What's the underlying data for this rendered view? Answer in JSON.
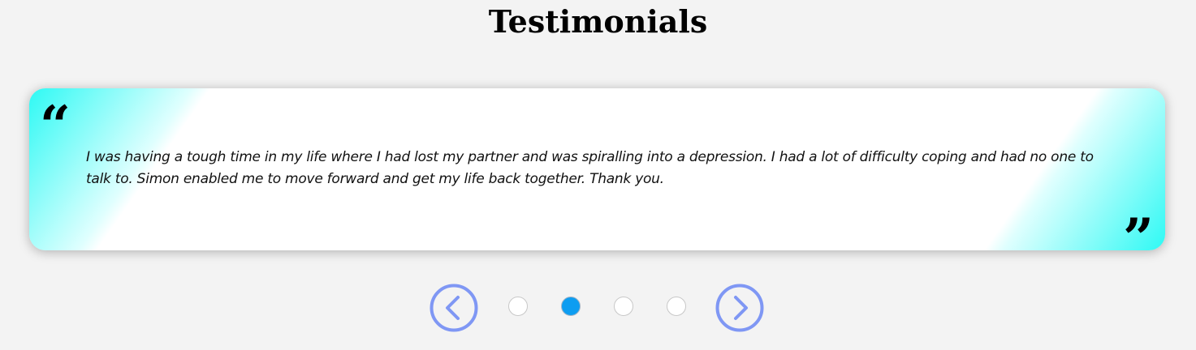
{
  "page": {
    "title": "Testimonials"
  },
  "testimonial": {
    "quote": "I was having a tough time in my life where I had lost my partner and was spiralling into a depression. I had a lot of difficulty coping and had no one to talk to. Simon enabled me to move forward and get my life back together. Thank you.",
    "open_quote_glyph": "“",
    "close_quote_glyph": "”"
  },
  "carousel": {
    "dots": [
      {
        "active": false
      },
      {
        "active": true
      },
      {
        "active": false
      },
      {
        "active": false
      }
    ],
    "prev_icon": "chevron-left-circle-icon",
    "next_icon": "chevron-right-circle-icon"
  },
  "colors": {
    "background": "#f3f3f3",
    "gradient_accent": "#2ef9f4",
    "arrow": "#7f97f4",
    "active_dot": "#0d9df1"
  }
}
